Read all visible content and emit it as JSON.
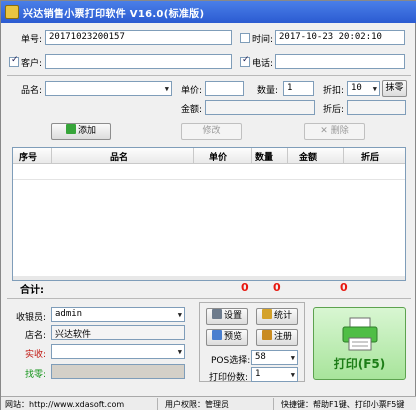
{
  "title": "兴达销售小票打印软件 V16.0(标准版)",
  "order": {
    "label": "单号:",
    "value": "20171023200157"
  },
  "time": {
    "label": "时间:",
    "value": "2017-10-23 20:02:10",
    "checked": false
  },
  "customer": {
    "label": "客户:",
    "value": "",
    "checked": true
  },
  "phone": {
    "label": "电话:",
    "value": "",
    "checked": true
  },
  "product": {
    "label": "品名:",
    "value": ""
  },
  "price": {
    "label": "单价:",
    "value": ""
  },
  "qty": {
    "label": "数量:",
    "value": "1"
  },
  "discount": {
    "label": "折扣:",
    "value": "10"
  },
  "amount": {
    "label": "金额:",
    "value": ""
  },
  "discounted": {
    "label": "折后:",
    "value": ""
  },
  "buttons": {
    "erase": "抹零",
    "add": "添加",
    "modify": "修改",
    "delete": "删除",
    "settings": "设置",
    "stats": "统计",
    "preview": "预览",
    "register": "注册",
    "print": "打印(F5)"
  },
  "table": {
    "columns": [
      "序号",
      "品名",
      "单价",
      "数量",
      "金额",
      "折后"
    ]
  },
  "totals": {
    "label": "合计:",
    "qty": "0",
    "amount": "0",
    "discounted": "0"
  },
  "cashier": {
    "label": "收银员:",
    "value": "admin"
  },
  "store": {
    "label": "店名:",
    "value": "兴达软件"
  },
  "received": {
    "label": "实收:",
    "value": ""
  },
  "change": {
    "label": "找零:",
    "value": ""
  },
  "pos": {
    "label": "POS选择:",
    "value": "58"
  },
  "copies": {
    "label": "打印份数:",
    "value": "1"
  },
  "status": {
    "website": "网站：http://www.xdasoft.com",
    "permission": "用户权限：管理员",
    "shortcuts": "快捷键：帮助F1键、打印小票F5键"
  },
  "colors": {
    "title": "#2b5bd1",
    "red": "#e8170e",
    "print_green": "#1d7d17"
  }
}
